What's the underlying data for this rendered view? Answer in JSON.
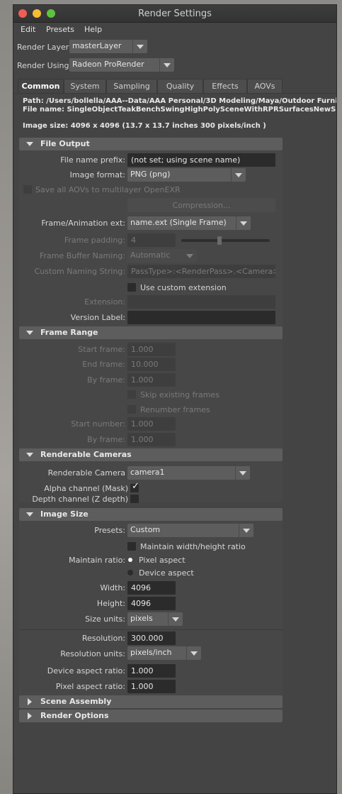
{
  "window": {
    "title": "Render Settings"
  },
  "menu": [
    "Edit",
    "Presets",
    "Help"
  ],
  "render_layer": {
    "label": "Render Layer",
    "value": "masterLayer"
  },
  "render_using": {
    "label": "Render Using",
    "value": "Radeon ProRender"
  },
  "tabs": [
    "Common",
    "System",
    "Sampling",
    "Quality",
    "Effects",
    "AOVs"
  ],
  "info": {
    "path": "Path: /Users/bollella/AAA--Data/AAA Personal/3D Modeling/Maya/Outdoor Furniture",
    "file_name": "File name:  SingleObjectTeakBenchSwingHighPolySceneWithRPRSurfacesNewSlab.png",
    "image_size": "Image size: 4096 x 4096 (13.7 x 13.7 inches 300 pixels/inch )"
  },
  "file_output": {
    "header": "File Output",
    "file_name_prefix_label": "File name prefix:",
    "file_name_prefix_value": "(not set; using scene name)",
    "image_format_label": "Image format:",
    "image_format_value": "PNG (png)",
    "save_all_aovs_label": "Save all AOVs to multilayer OpenEXR",
    "compression_label": "Compression...",
    "frame_anim_ext_label": "Frame/Animation ext:",
    "frame_anim_ext_value": "name.ext (Single Frame)",
    "frame_padding_label": "Frame padding:",
    "frame_padding_value": "4",
    "frame_buffer_naming_label": "Frame Buffer Naming:",
    "frame_buffer_naming_value": "Automatic",
    "custom_naming_label": "Custom Naming String:",
    "custom_naming_value": "PassType>:<RenderPass>.<Camera>",
    "use_custom_extension_label": "Use custom extension",
    "extension_label": "Extension:",
    "version_label_label": "Version Label:"
  },
  "frame_range": {
    "header": "Frame Range",
    "start_frame_label": "Start frame:",
    "start_frame_value": "1.000",
    "end_frame_label": "End frame:",
    "end_frame_value": "10.000",
    "by_frame_label": "By frame:",
    "by_frame_value": "1.000",
    "skip_existing_label": "Skip existing frames",
    "renumber_label": "Renumber frames",
    "start_number_label": "Start number:",
    "start_number_value": "1.000",
    "by_frame2_label": "By frame:",
    "by_frame2_value": "1.000"
  },
  "renderable_cameras": {
    "header": "Renderable Cameras",
    "camera_label": "Renderable Camera",
    "camera_value": "camera1",
    "alpha_label": "Alpha channel (Mask)",
    "alpha_checked": "✓",
    "depth_label": "Depth channel (Z depth)"
  },
  "image_size": {
    "header": "Image Size",
    "presets_label": "Presets:",
    "presets_value": "Custom",
    "maintain_wh_label": "Maintain width/height ratio",
    "maintain_ratio_label": "Maintain ratio:",
    "pixel_aspect_label": "Pixel aspect",
    "device_aspect_label": "Device aspect",
    "width_label": "Width:",
    "width_value": "4096",
    "height_label": "Height:",
    "height_value": "4096",
    "size_units_label": "Size units:",
    "size_units_value": "pixels",
    "resolution_label": "Resolution:",
    "resolution_value": "300.000",
    "resolution_units_label": "Resolution units:",
    "resolution_units_value": "pixels/inch",
    "device_aspect_ratio_label": "Device aspect ratio:",
    "device_aspect_ratio_value": "1.000",
    "pixel_aspect_ratio_label": "Pixel aspect ratio:",
    "pixel_aspect_ratio_value": "1.000"
  },
  "collapsed_sections": [
    "Scene Assembly",
    "Render Options"
  ]
}
